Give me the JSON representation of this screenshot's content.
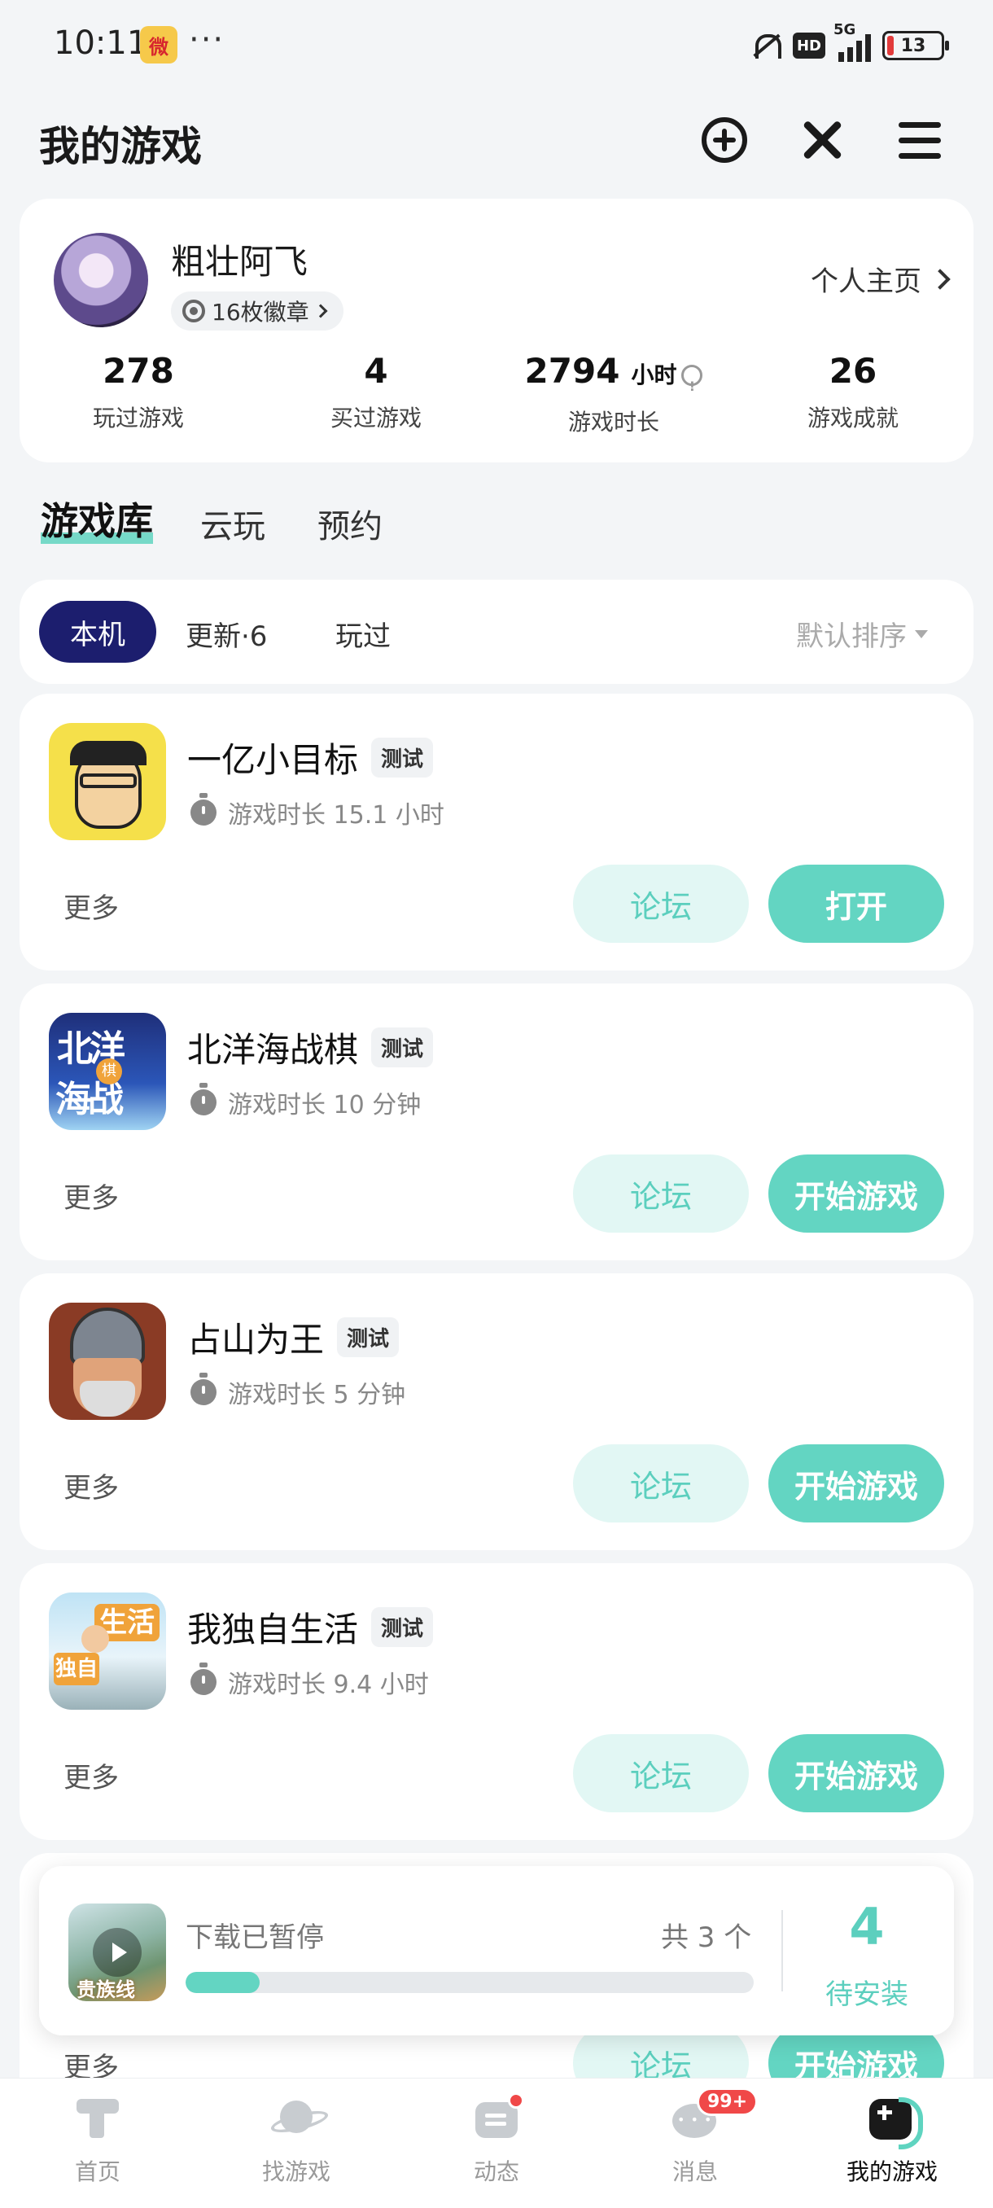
{
  "status_bar": {
    "time": "10:11",
    "weibo_icon": "weibo-icon",
    "more_dots": "···",
    "hd": "HD",
    "network": "5G",
    "battery": "13"
  },
  "header": {
    "title": "我的游戏",
    "icons": [
      "add-circle-icon",
      "tools-icon",
      "menu-icon"
    ]
  },
  "profile": {
    "username": "粗壮阿飞",
    "badges_label": "16枚徽章",
    "homepage_label": "个人主页",
    "stats": [
      {
        "value": "278",
        "unit": "",
        "label": "玩过游戏"
      },
      {
        "value": "4",
        "unit": "",
        "label": "买过游戏"
      },
      {
        "value": "2794",
        "unit": "小时",
        "label": "游戏时长"
      },
      {
        "value": "26",
        "unit": "",
        "label": "游戏成就"
      }
    ]
  },
  "library_tabs": [
    "游戏库",
    "云玩",
    "预约"
  ],
  "filters": {
    "active": "本机",
    "others": [
      "更新·6",
      "玩过"
    ],
    "sort_label": "默认排序"
  },
  "games": [
    {
      "name": "一亿小目标",
      "tag": "测试",
      "playtime": "游戏时长 15.1 小时",
      "more": "更多",
      "forum": "论坛",
      "action": "打开"
    },
    {
      "name": "北洋海战棋",
      "tag": "测试",
      "playtime": "游戏时长 10 分钟",
      "more": "更多",
      "forum": "论坛",
      "action": "开始游戏"
    },
    {
      "name": "占山为王",
      "tag": "测试",
      "playtime": "游戏时长 5 分钟",
      "more": "更多",
      "forum": "论坛",
      "action": "开始游戏"
    },
    {
      "name": "我独自生活",
      "tag": "测试",
      "playtime": "游戏时长 9.4 小时",
      "more": "更多",
      "forum": "论坛",
      "action": "开始游戏"
    },
    {
      "name": "",
      "tag": "",
      "playtime": "",
      "more": "更多",
      "forum": "论坛",
      "action": "开始游戏"
    }
  ],
  "download": {
    "status": "下载已暂停",
    "count": "共 3 个",
    "progress": 0.13,
    "pending_num": "4",
    "pending_label": "待安装"
  },
  "bottom_nav": [
    {
      "label": "首页",
      "icon": "home-icon"
    },
    {
      "label": "找游戏",
      "icon": "planet-icon"
    },
    {
      "label": "动态",
      "icon": "feed-icon"
    },
    {
      "label": "消息",
      "icon": "message-icon",
      "badge": "99+"
    },
    {
      "label": "我的游戏",
      "icon": "my-games-icon",
      "active": true
    }
  ],
  "colors": {
    "accent": "#63d5c2",
    "chip_active": "#1c1e6e",
    "badge_red": "#f04848"
  }
}
